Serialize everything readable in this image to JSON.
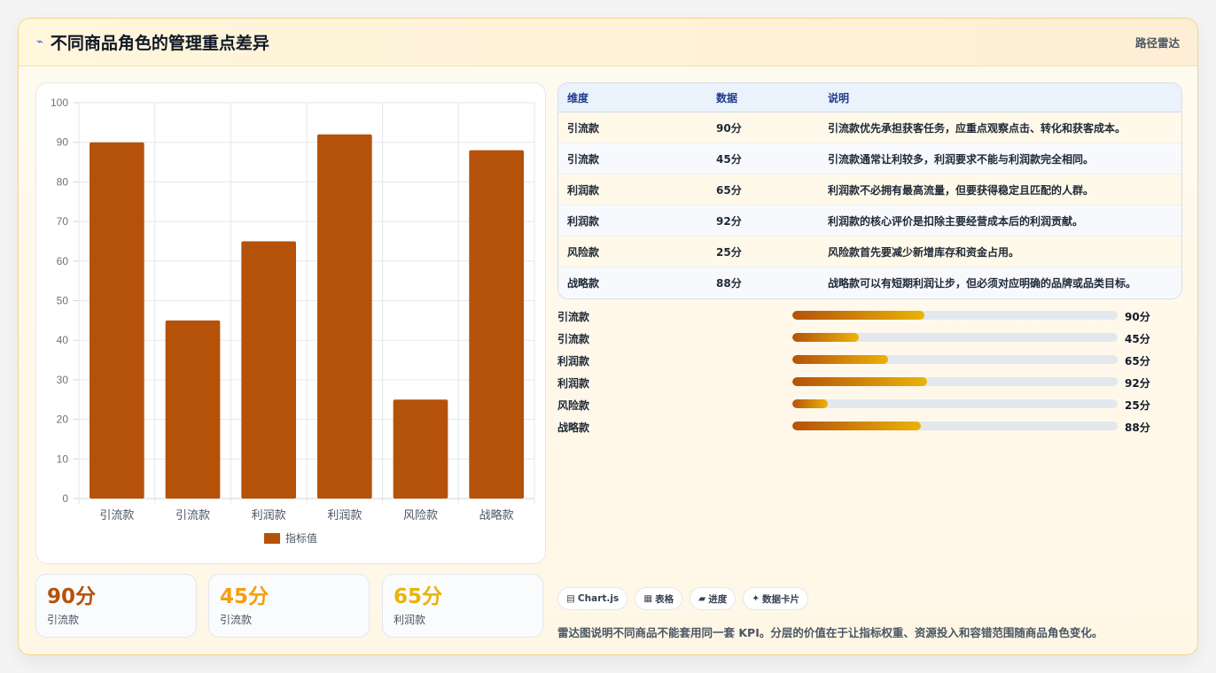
{
  "header": {
    "icon": "trend-line-icon",
    "title": "不同商品角色的管理重点差异",
    "tag": "路径雷达"
  },
  "chart_data": {
    "type": "bar",
    "categories": [
      "引流款",
      "引流款",
      "利润款",
      "利润款",
      "风险款",
      "战略款"
    ],
    "series": [
      {
        "name": "指标值",
        "values": [
          90,
          45,
          65,
          92,
          25,
          88
        ]
      }
    ],
    "ylim": [
      0,
      100
    ],
    "yticks": [
      "0",
      "10",
      "20",
      "30",
      "40",
      "50",
      "60",
      "70",
      "80",
      "90",
      "100"
    ],
    "legend_position": "bottom",
    "grid": true,
    "color": "#b5520a"
  },
  "table": {
    "headers": [
      "维度",
      "数据",
      "说明"
    ],
    "rows": [
      {
        "dim": "引流款",
        "data": "90分",
        "note": "引流款优先承担获客任务，应重点观察点击、转化和获客成本。"
      },
      {
        "dim": "引流款",
        "data": "45分",
        "note": "引流款通常让利较多，利润要求不能与利润款完全相同。"
      },
      {
        "dim": "利润款",
        "data": "65分",
        "note": "利润款不必拥有最高流量，但要获得稳定且匹配的人群。"
      },
      {
        "dim": "利润款",
        "data": "92分",
        "note": "利润款的核心评价是扣除主要经营成本后的利润贡献。"
      },
      {
        "dim": "风险款",
        "data": "25分",
        "note": "风险款首先要减少新增库存和资金占用。"
      },
      {
        "dim": "战略款",
        "data": "88分",
        "note": "战略款可以有短期利润让步，但必须对应明确的品牌或品类目标。"
      }
    ]
  },
  "progress": [
    {
      "name": "引流款",
      "value": 90,
      "label": "90分",
      "fill_fraction": 0.405
    },
    {
      "name": "引流款",
      "value": 45,
      "label": "45分",
      "fill_fraction": 0.205
    },
    {
      "name": "利润款",
      "value": 65,
      "label": "65分",
      "fill_fraction": 0.295
    },
    {
      "name": "利润款",
      "value": 92,
      "label": "92分",
      "fill_fraction": 0.415
    },
    {
      "name": "风险款",
      "value": 25,
      "label": "25分",
      "fill_fraction": 0.11
    },
    {
      "name": "战略款",
      "value": 88,
      "label": "88分",
      "fill_fraction": 0.395
    }
  ],
  "stats": [
    {
      "value": "90分",
      "label": "引流款",
      "color": "#b5520a"
    },
    {
      "value": "45分",
      "label": "引流款",
      "color": "#f59e0b"
    },
    {
      "value": "65分",
      "label": "利润款",
      "color": "#eab308"
    }
  ],
  "chips": [
    {
      "icon": "chart-icon",
      "glyph": "▤",
      "label": "Chart.js"
    },
    {
      "icon": "table-icon",
      "glyph": "▦",
      "label": "表格"
    },
    {
      "icon": "progress-icon",
      "glyph": "▰",
      "label": "进度"
    },
    {
      "icon": "sparkle-icon",
      "glyph": "✦",
      "label": "数据卡片"
    }
  ],
  "footnote": "雷达图说明不同商品不能套用同一套 KPI。分层的价值在于让指标权重、资源投入和容错范围随商品角色变化。"
}
